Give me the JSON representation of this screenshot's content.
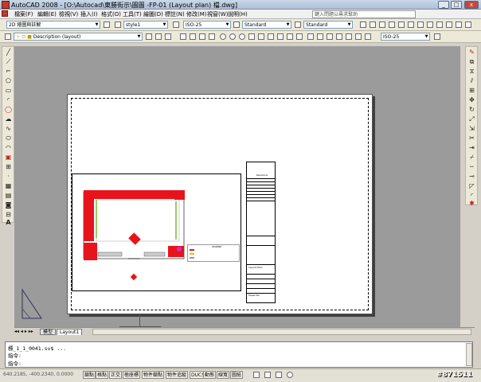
{
  "titlebar": {
    "title": "AutoCAD 2008 - [O:\\Autocad\\東勝街示\\圖圖 -FP-01 (Layout plan) 檔.dwg]"
  },
  "window_controls": {
    "minimize": "_",
    "maximize": "□",
    "close": "x"
  },
  "menu": {
    "items": [
      "檔案(F)",
      "編輯(E)",
      "檢視(V)",
      "插入(I)",
      "格式(O)",
      "工具(T)",
      "繪圖(D)",
      "標註(N)",
      "修改(M)",
      "視窗(W)",
      "說明(H)"
    ],
    "help_placeholder": "鍵入問題以尋求幫助"
  },
  "toolbar1": {
    "workspace": "2D 繪圖與註解",
    "text_style": "style1",
    "dim_style": "ISO-25",
    "table_style": "Standard",
    "multileader_style": "Standard"
  },
  "toolbar2": {
    "layer": "Description (layout)",
    "dim_style2": "ISO-25"
  },
  "tabs": {
    "model": "模型",
    "layout": "Layout1"
  },
  "command": {
    "history": "標_1_1_0041.sv$ ...",
    "line1": "指令:",
    "line2": "指令:"
  },
  "status": {
    "coords": "640.2185, -400.2340, 0.0000",
    "buttons": [
      "鎖點",
      "格點",
      "正交",
      "極座標",
      "物件鎖點",
      "物件追蹤",
      "DUCS",
      "動態",
      "線寬",
      "圖紙"
    ],
    "watermark": "#871511"
  },
  "drawing": {
    "title_block_header": "Revisions",
    "sheet_text": "Sheet No.",
    "drawing_title": "Layout Plan",
    "legend_header": "LEGEND"
  },
  "colors": {
    "accent_red": "#e8141b",
    "paper": "#ffffff",
    "model_bg": "#9b9b9b"
  }
}
